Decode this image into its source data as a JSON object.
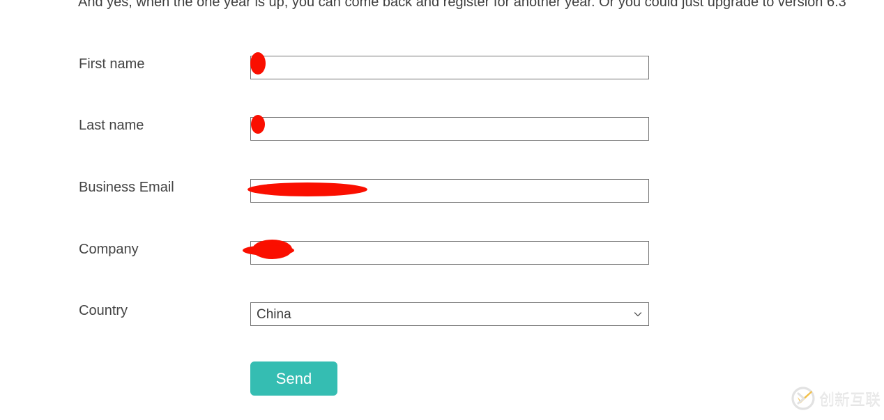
{
  "intro": {
    "text": "And yes, when the one year is up, you can come back and register for another year. Or you could just upgrade to version 6.3"
  },
  "form": {
    "fields": [
      {
        "label": "First name",
        "name": "first-name",
        "type": "text",
        "value": "",
        "placeholder": "",
        "redacted": true
      },
      {
        "label": "Last name",
        "name": "last-name",
        "type": "text",
        "value": "",
        "placeholder": "",
        "redacted": true
      },
      {
        "label": "Business Email",
        "name": "business-email",
        "type": "text",
        "value": "",
        "placeholder": "",
        "redacted": true
      },
      {
        "label": "Company",
        "name": "company",
        "type": "text",
        "value": "",
        "placeholder": "",
        "redacted": true
      },
      {
        "label": "Country",
        "name": "country",
        "type": "select",
        "value": "China",
        "placeholder": "",
        "redacted": false
      }
    ],
    "country_selected": "China",
    "submit_label": "Send"
  },
  "colors": {
    "accent_button": "#35bdb2",
    "redaction": "#fa0f00",
    "label_text": "#444444",
    "input_border": "#737373",
    "page_background": "#ffffff"
  },
  "watermark": {
    "text": "创新互联",
    "icon": "circle-x-logo-icon"
  }
}
